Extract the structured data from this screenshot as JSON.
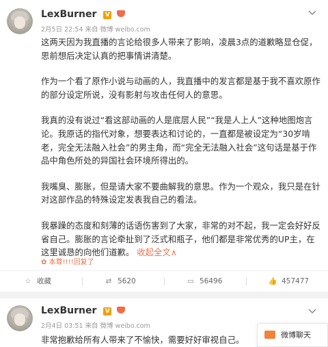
{
  "post1": {
    "username": "LexBurner",
    "meta": "2月5日 22:54 来自 微博 weibo.com",
    "paragraphs": [
      "这两天因为我直播的言论给很多人带来了影响，凌晨3点的道歉略显仓促，思前想后决定认真的把事情讲清楚。",
      "作为一个看了原作小说与动画的人，我直播中的发言都是基于我不喜欢原作的部分设定所说，没有影射与攻击任何人的意思。",
      "我真的没有说过“看这部动画的人是底层人民”“我是人上人”这种地图炮言论。我原话的指代对象，想要表达和讨论的，一直都是被设定为“30岁啃老，完全无法融入社会”的男主角，而“完全无法融入社会”这句话是基于作品中角色所处的异国社会环境所得出的。",
      "我嘴臭、膨胀，但是请大家不要曲解我的意思。作为一个观众，我只是在针对这部作品的特殊设定发表我自己的看法。"
    ],
    "last_paragraph": "我暴躁的态度和刻薄的话语伤害到了大家，非常的对不起，我一定会好好反省自己。膨胀的言论牵扯到了泛式和瓶子，他们都是非常优秀的UP主，在这里诚恳的向他们道歉。",
    "collapse_label": "收起全文",
    "collapse_arrow": "∧",
    "pinned_label": "本尊!!!!回复了",
    "actions": {
      "favorite": "收藏",
      "repost": "5620",
      "comment": "56496",
      "like": "457477"
    }
  },
  "post2": {
    "username": "LexBurner",
    "meta": "2月4日 03:51 来自 微博 weibo.com",
    "text": "非常抱歉给所有人带来了不愉快，需要好好审视自己。"
  },
  "chat": {
    "label": "微博聊天"
  },
  "icons": {
    "verified": "verified-v-icon",
    "vip": "vip-crown-icon",
    "more": "chevron-down-icon",
    "favorite": "star-icon",
    "repost": "repost-icon",
    "comment": "comment-icon",
    "like": "thumbs-up-icon",
    "chat": "chat-icon"
  },
  "colors": {
    "accent": "#eb7350",
    "verified": "#f5a000"
  }
}
